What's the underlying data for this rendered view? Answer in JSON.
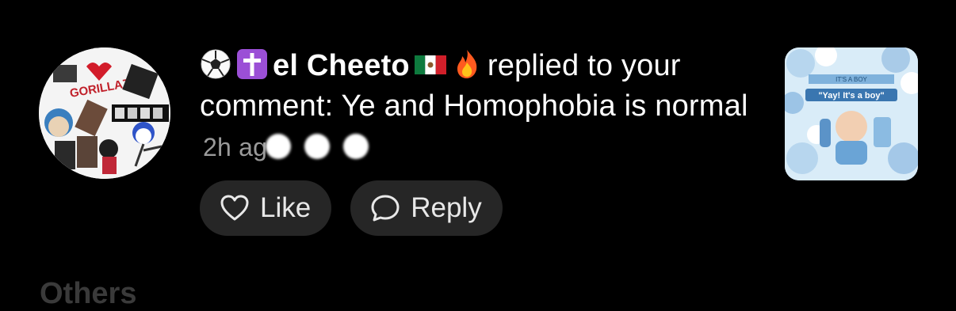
{
  "notification": {
    "emojis": [
      "soccer-ball",
      "latin-cross",
      "mexico-flag",
      "fire"
    ],
    "username": "el Cheeto",
    "message_line": "replied to your comment: Ye and Homophobia is normal",
    "time": "2h ag",
    "avatar": {
      "text": "GORILLAZ"
    },
    "thumbnail": {
      "caption": "\"Yay! It's a boy\"",
      "banner": "IT'S A BOY"
    }
  },
  "actions": {
    "like_label": "Like",
    "reply_label": "Reply"
  },
  "section": {
    "title": "Others"
  },
  "colors": {
    "background": "#000000",
    "pill_background": "#262626",
    "timestamp": "#9a9a9a",
    "section_header": "#3a3a3a"
  }
}
